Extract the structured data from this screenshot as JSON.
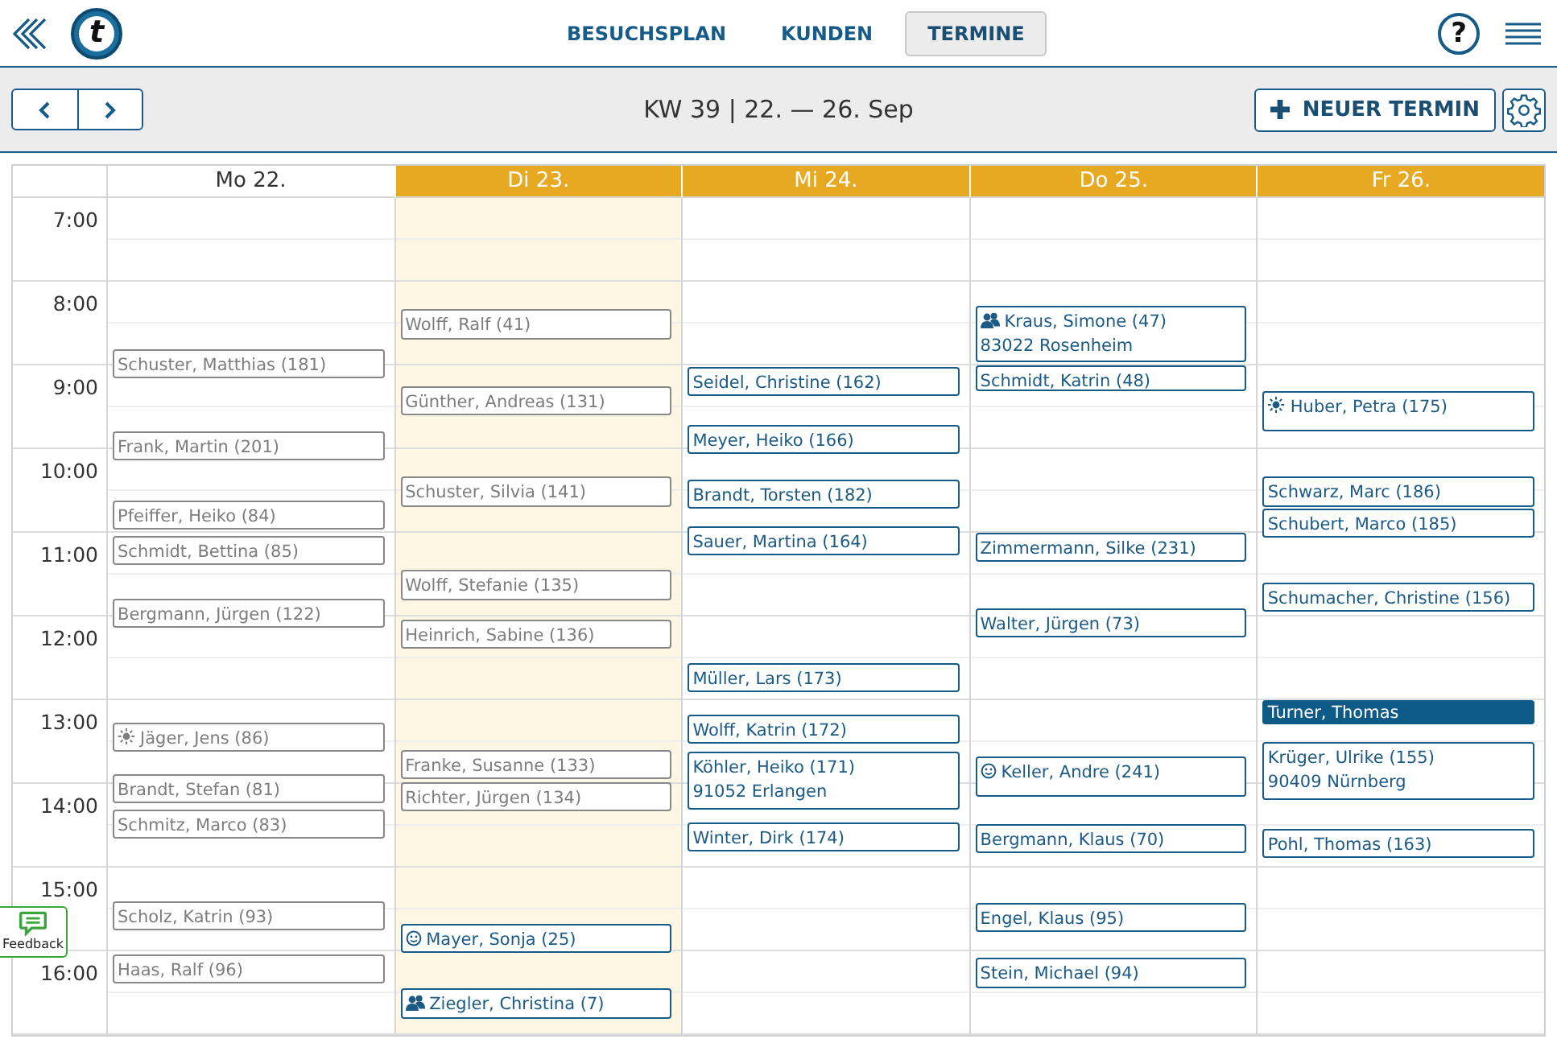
{
  "topbar": {
    "logo": "t",
    "nav": [
      {
        "label": "BESUCHSPLAN",
        "selected": false
      },
      {
        "label": "KUNDEN",
        "selected": false
      },
      {
        "label": "TERMINE",
        "selected": true
      }
    ],
    "help": "?"
  },
  "toolbar": {
    "title": "KW 39 | 22. — 26. Sep",
    "new_button": "NEUER TERMIN"
  },
  "hours": [
    "7:00",
    "8:00",
    "9:00",
    "10:00",
    "11:00",
    "12:00",
    "13:00",
    "14:00",
    "15:00",
    "16:00"
  ],
  "days": [
    {
      "label": "Mo 22.",
      "past": true,
      "today": false,
      "events": [
        {
          "kind": "plain",
          "name": "Schuster, Matthias (181)",
          "past": true,
          "selected": false
        },
        {
          "kind": "plain",
          "name": "Frank, Martin (201)",
          "past": true,
          "selected": false
        },
        {
          "kind": "plain",
          "name": "Pfeiffer, Heiko (84)",
          "past": true,
          "selected": false
        },
        {
          "kind": "plain",
          "name": "Schmidt, Bettina (85)",
          "past": true,
          "selected": false
        },
        {
          "kind": "plain",
          "name": "Bergmann, Jürgen (122)",
          "past": true,
          "selected": false
        },
        {
          "kind": "sun",
          "name": "Jäger, Jens (86)",
          "past": true,
          "selected": false
        },
        {
          "kind": "plain",
          "name": "Brandt, Stefan (81)",
          "past": true,
          "selected": false
        },
        {
          "kind": "plain",
          "name": "Schmitz, Marco (83)",
          "past": true,
          "selected": false
        },
        {
          "kind": "plain",
          "name": "Scholz, Katrin (93)",
          "past": true,
          "selected": false
        },
        {
          "kind": "plain",
          "name": "Haas, Ralf (96)",
          "past": true,
          "selected": false
        }
      ]
    },
    {
      "label": "Di 23.",
      "past": false,
      "today": true,
      "events": [
        {
          "kind": "plain",
          "name": "Wolff, Ralf (41)",
          "past": true,
          "selected": false
        },
        {
          "kind": "plain",
          "name": "Günther, Andreas (131)",
          "past": true,
          "selected": false
        },
        {
          "kind": "plain",
          "name": "Schuster, Silvia (141)",
          "past": true,
          "selected": false
        },
        {
          "kind": "plain",
          "name": "Wolff, Stefanie (135)",
          "past": true,
          "selected": false
        },
        {
          "kind": "plain",
          "name": "Heinrich, Sabine (136)",
          "past": true,
          "selected": false
        },
        {
          "kind": "plain",
          "name": "Franke, Susanne (133)",
          "past": true,
          "selected": false
        },
        {
          "kind": "plain",
          "name": "Richter, Jürgen (134)",
          "past": true,
          "selected": false
        },
        {
          "kind": "face",
          "name": "Mayer, Sonja (25)",
          "past": false,
          "selected": false
        },
        {
          "kind": "people",
          "name": "Ziegler, Christina (7)",
          "past": false,
          "selected": false
        }
      ]
    },
    {
      "label": "Mi 24.",
      "past": false,
      "today": false,
      "events": [
        {
          "kind": "plain",
          "name": "Seidel, Christine (162)",
          "past": false,
          "selected": false
        },
        {
          "kind": "plain",
          "name": "Meyer, Heiko (166)",
          "past": false,
          "selected": false
        },
        {
          "kind": "plain",
          "name": "Brandt, Torsten (182)",
          "past": false,
          "selected": false
        },
        {
          "kind": "plain",
          "name": "Sauer, Martina (164)",
          "past": false,
          "selected": false
        },
        {
          "kind": "plain",
          "name": "Müller, Lars (173)",
          "past": false,
          "selected": false
        },
        {
          "kind": "plain",
          "name": "Wolff, Katrin (172)",
          "past": false,
          "selected": false
        },
        {
          "kind": "plain",
          "name": "Köhler, Heiko (171)",
          "address": "91052 Erlangen",
          "past": false,
          "selected": false
        },
        {
          "kind": "plain",
          "name": "Winter, Dirk (174)",
          "past": false,
          "selected": false
        }
      ]
    },
    {
      "label": "Do 25.",
      "past": false,
      "today": false,
      "events": [
        {
          "kind": "people",
          "name": "Kraus, Simone (47)",
          "address": "83022 Rosenheim",
          "past": false,
          "selected": false
        },
        {
          "kind": "plain",
          "name": "Schmidt, Katrin (48)",
          "past": false,
          "selected": false
        },
        {
          "kind": "plain",
          "name": "Zimmermann, Silke (231)",
          "past": false,
          "selected": false
        },
        {
          "kind": "plain",
          "name": "Walter, Jürgen (73)",
          "past": false,
          "selected": false
        },
        {
          "kind": "face",
          "name": "Keller, Andre (241)",
          "past": false,
          "selected": false
        },
        {
          "kind": "plain",
          "name": "Bergmann, Klaus (70)",
          "past": false,
          "selected": false
        },
        {
          "kind": "plain",
          "name": "Engel, Klaus (95)",
          "past": false,
          "selected": false
        },
        {
          "kind": "plain",
          "name": "Stein, Michael (94)",
          "past": false,
          "selected": false
        }
      ]
    },
    {
      "label": "Fr 26.",
      "past": false,
      "today": false,
      "events": [
        {
          "kind": "sun",
          "name": "Huber, Petra (175)",
          "past": false,
          "selected": false
        },
        {
          "kind": "plain",
          "name": "Schwarz, Marc (186)",
          "past": false,
          "selected": false
        },
        {
          "kind": "plain",
          "name": "Schubert, Marco (185)",
          "past": false,
          "selected": false
        },
        {
          "kind": "plain",
          "name": "Schumacher, Christine (156)",
          "past": false,
          "selected": false
        },
        {
          "kind": "plain",
          "name": "Turner, Thomas",
          "past": false,
          "selected": true
        },
        {
          "kind": "plain",
          "name": "Krüger, Ulrike (155)",
          "address": "90409 Nürnberg",
          "past": false,
          "selected": false
        },
        {
          "kind": "plain",
          "name": "Pohl, Thomas (163)",
          "past": false,
          "selected": false
        }
      ]
    }
  ],
  "feedback": "Feedback"
}
